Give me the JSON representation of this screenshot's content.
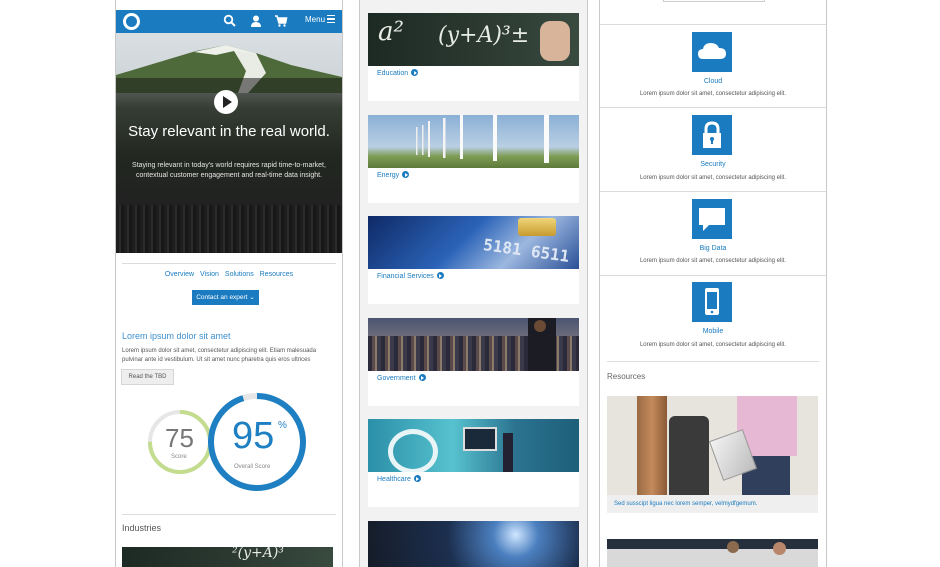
{
  "header": {
    "menu_label": "Menu"
  },
  "hero": {
    "title": "Stay relevant in the real world.",
    "text": "Staying relevant in today's world requires rapid time-to-market, contextual customer engagement and real-time data insight."
  },
  "nav": {
    "items": [
      "Overview",
      "Vision",
      "Solutions",
      "Resources"
    ]
  },
  "contact_button": "Contact an expert",
  "intro": {
    "heading": "Lorem ipsum dolor sit amet",
    "body": "Lorem ipsum dolor sit amet, consectetur adipiscing elit. Etiam malesuada pulvinar ante id vestibulum. Ut sit amet nunc pharetra quis eros ultrices",
    "button": "Read the TBD"
  },
  "scores": {
    "score": {
      "value": "75",
      "percent": 75,
      "label": "Score"
    },
    "overall": {
      "value": "95",
      "unit": "%",
      "percent": 95,
      "label": "Overall Score"
    }
  },
  "industries": {
    "label": "Industries",
    "cards": [
      {
        "caption": "Education"
      },
      {
        "caption": "Energy"
      },
      {
        "caption": "Financial Services"
      },
      {
        "caption": "Government"
      },
      {
        "caption": "Healthcare"
      }
    ]
  },
  "services": [
    {
      "name": "Cloud",
      "text": "Lorem ipsum dolor sit amet, consectetur adipiscing elit.",
      "icon": "cloud-icon"
    },
    {
      "name": "Security",
      "text": "Lorem ipsum dolor sit amet, consectetur adipiscing elit.",
      "icon": "lock-icon"
    },
    {
      "name": "Big Data",
      "text": "Lorem ipsum dolor sit amet, consectetur adipiscing elit.",
      "icon": "speech-bubble-icon"
    },
    {
      "name": "Mobile",
      "text": "Lorem ipsum dolor sit amet, consectetur adipiscing elit.",
      "icon": "mobile-phone-icon"
    }
  ],
  "resources": {
    "label": "Resources",
    "caption": "Sed susscipt ligua nec lorem semper, velmydfgemum."
  },
  "colors": {
    "brand_blue": "#1a7bc0",
    "gauge_blue": "#1e7fc2",
    "gauge_green": "#c4dc8e"
  }
}
